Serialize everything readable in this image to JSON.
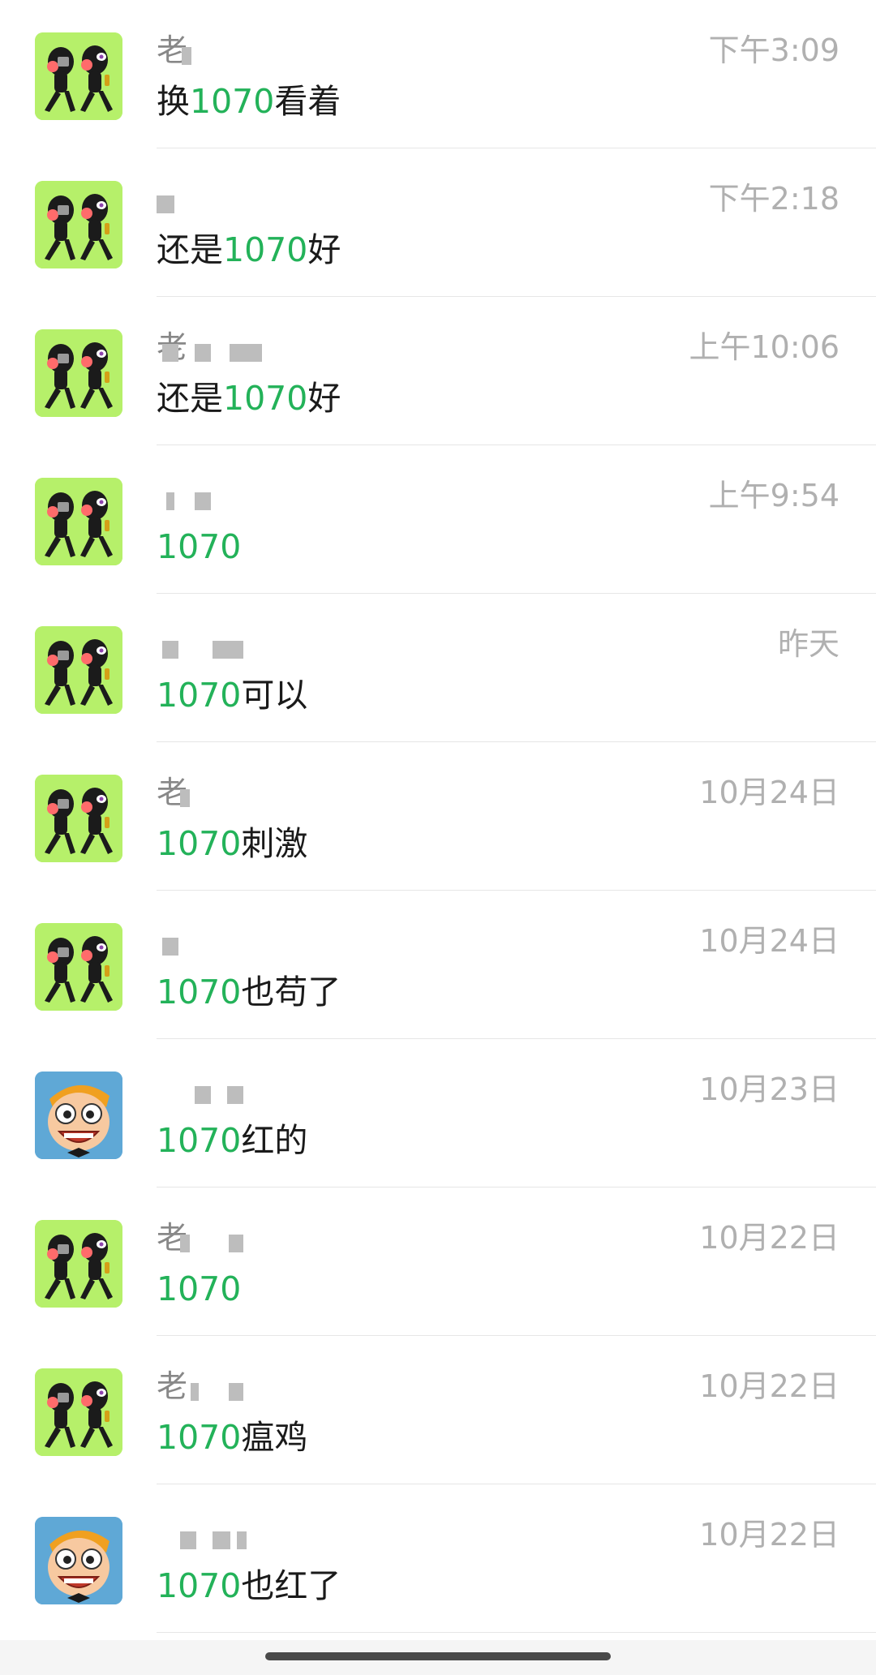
{
  "chats": [
    {
      "name": "老",
      "time": "下午3:09",
      "msg_prefix": "换",
      "msg_highlight": "1070",
      "msg_suffix": "看着",
      "avatar": "cartoon-duo-avatar"
    },
    {
      "name": "",
      "time": "下午2:18",
      "msg_prefix": "还是",
      "msg_highlight": "1070",
      "msg_suffix": "好",
      "avatar": "cartoon-duo-avatar"
    },
    {
      "name": "老",
      "time": "上午10:06",
      "msg_prefix": "还是",
      "msg_highlight": "1070",
      "msg_suffix": "好",
      "avatar": "cartoon-duo-avatar"
    },
    {
      "name": "",
      "time": "上午9:54",
      "msg_prefix": "",
      "msg_highlight": "1070",
      "msg_suffix": "",
      "avatar": "cartoon-duo-avatar"
    },
    {
      "name": "",
      "time": "昨天",
      "msg_prefix": "",
      "msg_highlight": "1070",
      "msg_suffix": "可以",
      "avatar": "cartoon-duo-avatar"
    },
    {
      "name": "老",
      "time": "10月24日",
      "msg_prefix": "",
      "msg_highlight": "1070",
      "msg_suffix": "刺激",
      "avatar": "cartoon-duo-avatar"
    },
    {
      "name": "",
      "time": "10月24日",
      "msg_prefix": "",
      "msg_highlight": "1070",
      "msg_suffix": "也苟了",
      "avatar": "cartoon-duo-avatar"
    },
    {
      "name": "",
      "time": "10月23日",
      "msg_prefix": "",
      "msg_highlight": "1070",
      "msg_suffix": "红的",
      "avatar": "cartoon-face-avatar"
    },
    {
      "name": "老",
      "time": "10月22日",
      "msg_prefix": "",
      "msg_highlight": "1070",
      "msg_suffix": "",
      "avatar": "cartoon-duo-avatar"
    },
    {
      "name": "老",
      "time": "10月22日",
      "msg_prefix": "",
      "msg_highlight": "1070",
      "msg_suffix": "瘟鸡",
      "avatar": "cartoon-duo-avatar"
    },
    {
      "name": "",
      "time": "10月22日",
      "msg_prefix": "",
      "msg_highlight": "1070",
      "msg_suffix": "也红了",
      "avatar": "cartoon-face-avatar"
    }
  ],
  "colors": {
    "highlight": "#23b259",
    "time": "#b0b0b0",
    "name": "#888888",
    "divider": "#e6e6e6"
  }
}
